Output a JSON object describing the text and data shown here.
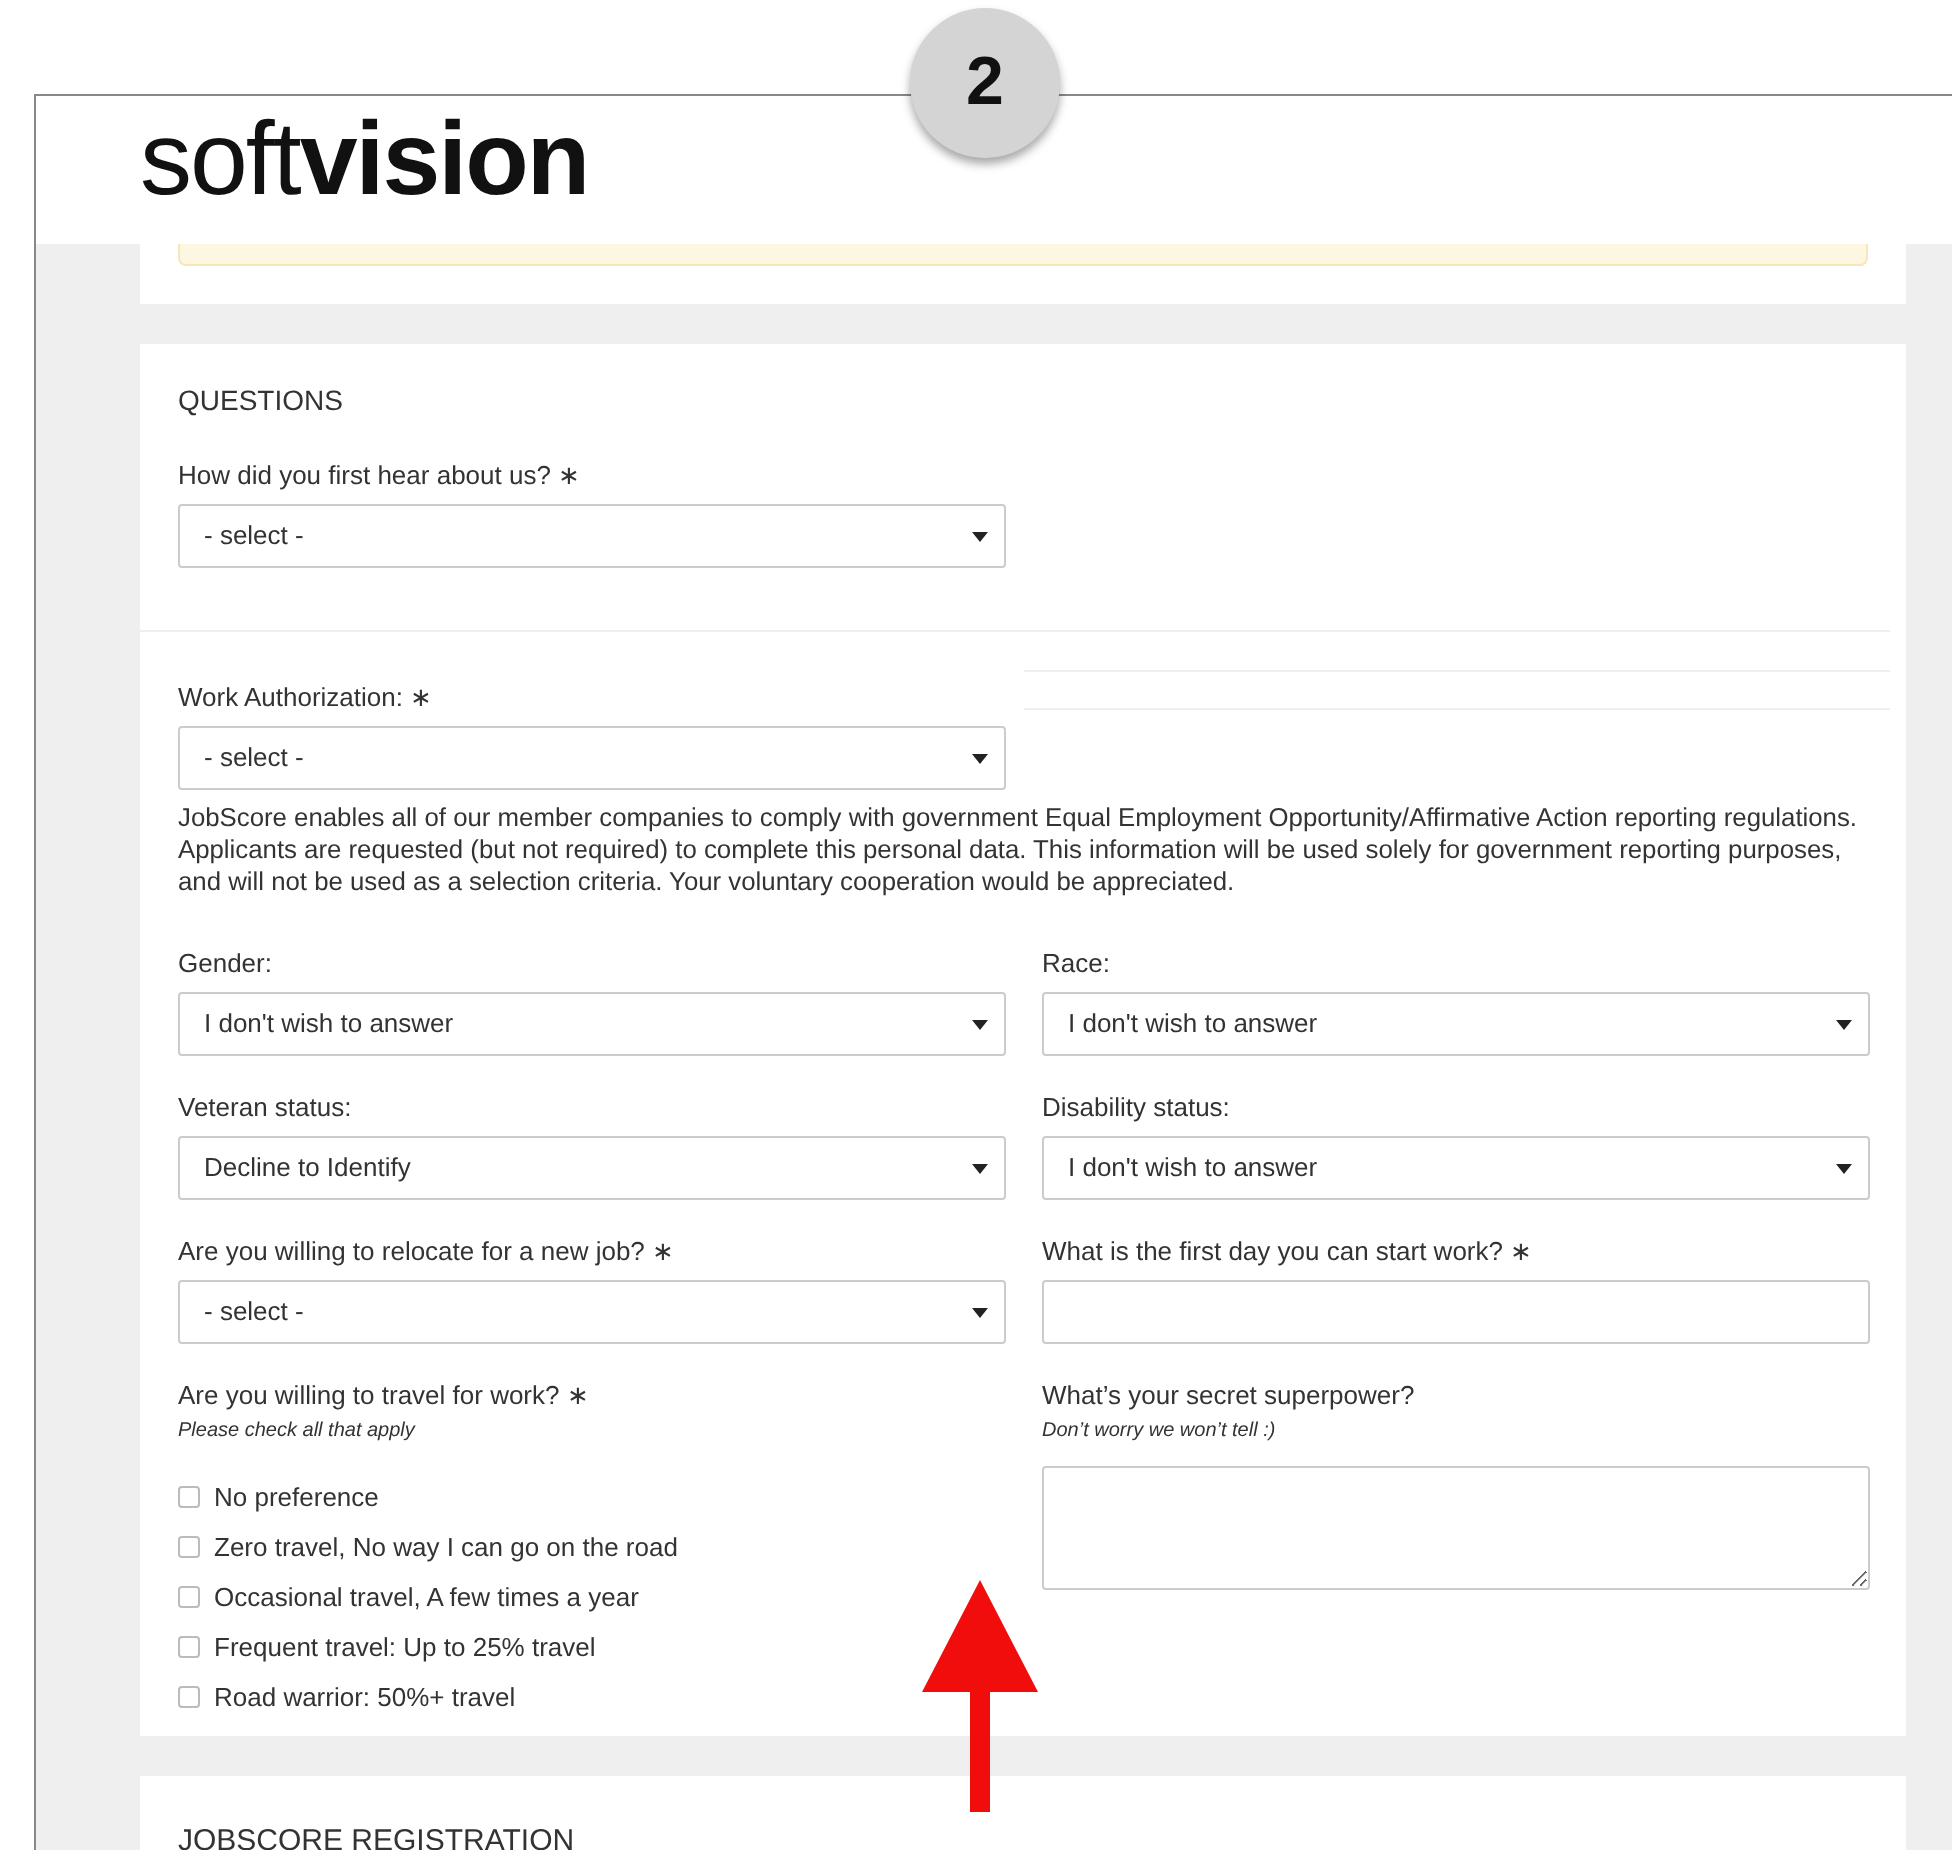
{
  "logo": {
    "light": "soft",
    "bold": "vision"
  },
  "step_badge": "2",
  "questions": {
    "title": "QUESTIONS",
    "top_fields": [
      {
        "label": "How did you first hear about us? ∗",
        "value": "- select -"
      },
      {
        "label": "Work Authorization: ∗",
        "value": "- select -"
      }
    ],
    "notice": "JobScore enables all of our member companies to comply with government Equal Employment Opportunity/Affirmative Action reporting regulations. Applicants are requested (but not required) to complete this personal data. This information will be used solely for government reporting purposes, and will not be used as a selection criteria. Your voluntary cooperation would be appreciated.",
    "fields": [
      {
        "kind": "select",
        "label": "Gender:",
        "value": "I don't wish to answer"
      },
      {
        "kind": "select",
        "label": "Race:",
        "value": "I don't wish to answer"
      },
      {
        "kind": "select",
        "label": "Veteran status:",
        "value": "Decline to Identify"
      },
      {
        "kind": "select",
        "label": "Disability status:",
        "value": "I don't wish to answer"
      },
      {
        "kind": "select",
        "label": "Are you willing to relocate for a new job? ∗",
        "value": "- select -"
      },
      {
        "kind": "text",
        "label": "What is the first day you can start work? ∗"
      },
      {
        "kind": "checkboxes",
        "label": "Are you willing to travel for work? ∗",
        "hint": "Please check all that apply",
        "options": [
          {
            "label": "No preference",
            "checked": false
          },
          {
            "label": "Zero travel, No way I can go on the road",
            "checked": false
          },
          {
            "label": "Occasional travel, A few times a year",
            "checked": false
          },
          {
            "label": "Frequent travel: Up to 25% travel",
            "checked": false
          },
          {
            "label": "Road warrior: 50%+ travel",
            "checked": false
          }
        ]
      },
      {
        "kind": "textarea",
        "label": "What’s your secret superpower?",
        "hint": "Don’t worry we won’t tell :)"
      }
    ]
  },
  "registration": {
    "title": "JOBSCORE REGISTRATION"
  }
}
